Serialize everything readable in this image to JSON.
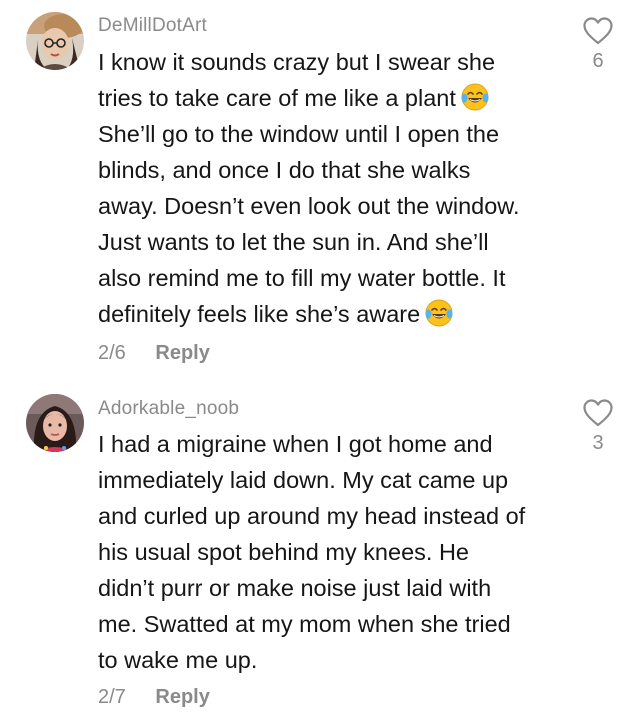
{
  "comments": [
    {
      "username": "DeMillDotArt",
      "lines": [
        "I know it sounds crazy but I swear she",
        "tries to take care of me like a plant",
        "She’ll go to the window until I open the",
        "blinds, and once I do that she walks",
        "away. Doesn’t even look out the window.",
        "Just wants to let the sun in. And she’ll",
        "also remind me to fill my water bottle. It",
        "definitely feels like she’s aware"
      ],
      "emoji": "tears-of-joy",
      "date": "2/6",
      "reply_label": "Reply",
      "like_count": "6"
    },
    {
      "username": "Adorkable_noob",
      "lines": [
        "I had a migraine when I got home and",
        "immediately laid down. My cat came up",
        "and curled up around my head instead of",
        "his usual spot behind my knees. He",
        "didn’t purr or make noise just laid with",
        "me. Swatted at my mom when she tried",
        "to wake me up."
      ],
      "date": "2/7",
      "reply_label": "Reply",
      "like_count": "3"
    }
  ],
  "colors": {
    "text": "#161616",
    "muted": "#8a8a8a",
    "emoji_face": "#fcc21b"
  }
}
